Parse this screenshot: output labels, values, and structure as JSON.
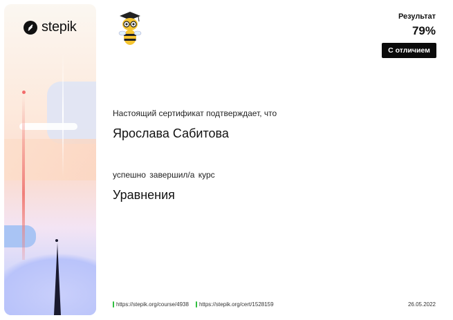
{
  "brand": {
    "name": "stepik"
  },
  "icons": {
    "logo": "stepik-logo-icon",
    "mascot": "bee-mascot-icon",
    "link_marker": "green-bar-icon"
  },
  "colors": {
    "badge_bg": "#0b0b0b",
    "link_marker": "#2fbf3f"
  },
  "result": {
    "label": "Результат",
    "value": "79%",
    "distinction": "С отличием"
  },
  "certificate": {
    "statement": "Настоящий сертификат подтверждает, что",
    "recipient": "Ярослава Сабитова",
    "completed": "успешно завершил/а курс",
    "course_title": "Уравнения"
  },
  "footer": {
    "course_url": "https://stepik.org/course/4938",
    "cert_url": "https://stepik.org/cert/1528159",
    "date": "26.05.2022"
  }
}
